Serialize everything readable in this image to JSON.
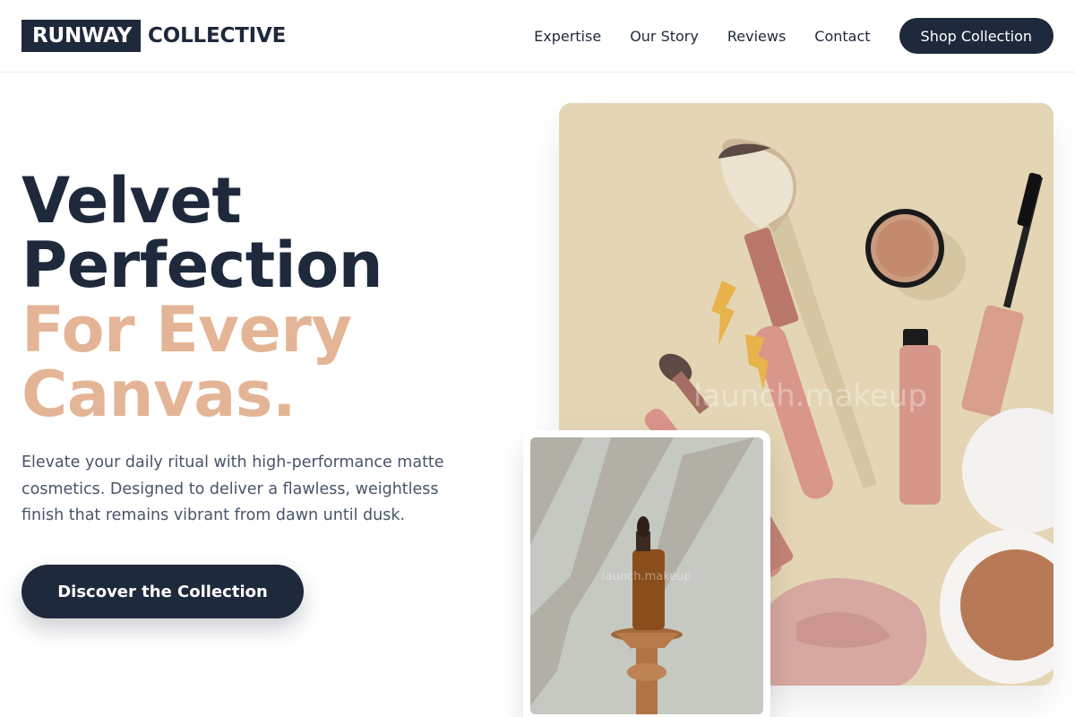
{
  "brand": {
    "box": "RUNWAY",
    "text": "COLLECTIVE"
  },
  "nav": {
    "links": [
      "Expertise",
      "Our Story",
      "Reviews",
      "Contact"
    ],
    "cta": "Shop Collection"
  },
  "hero": {
    "title_line1": "Velvet",
    "title_line2": "Perfection",
    "title_line3": "For Every",
    "title_line4": "Canvas.",
    "description": "Elevate your daily ritual with high-performance matte cosmetics. Designed to deliver a flawless, weightless finish that remains vibrant from dawn until dusk.",
    "cta": "Discover the Collection"
  },
  "images": {
    "main_watermark": "launch.makeup",
    "sub_watermark": "launch.makeup"
  },
  "colors": {
    "navy": "#1e293b",
    "accent": "#e3b596",
    "beige": "#e5d7b6",
    "rose": "#d49a8a"
  }
}
